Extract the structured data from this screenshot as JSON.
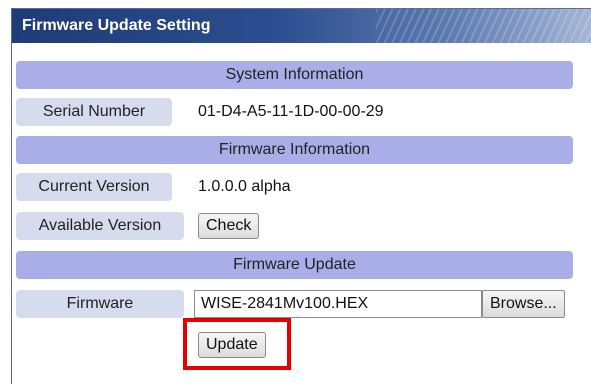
{
  "panel": {
    "title": "Firmware Update Setting"
  },
  "system_info": {
    "header": "System Information",
    "serial_label": "Serial Number",
    "serial_value": "01-D4-A5-11-1D-00-00-29"
  },
  "firmware_info": {
    "header": "Firmware Information",
    "current_label": "Current Version",
    "current_value": "1.0.0.0 alpha",
    "available_label": "Available Version",
    "check_button": "Check"
  },
  "firmware_update": {
    "header": "Firmware Update",
    "firmware_label": "Firmware",
    "file_value": "WISE-2841Mv100.HEX",
    "browse_button": "Browse...",
    "update_button": "Update"
  },
  "colors": {
    "section_bar": "#a9aee8",
    "label_cell": "#d6dbee",
    "header_dark": "#1f3b78",
    "highlight": "#e60000"
  }
}
